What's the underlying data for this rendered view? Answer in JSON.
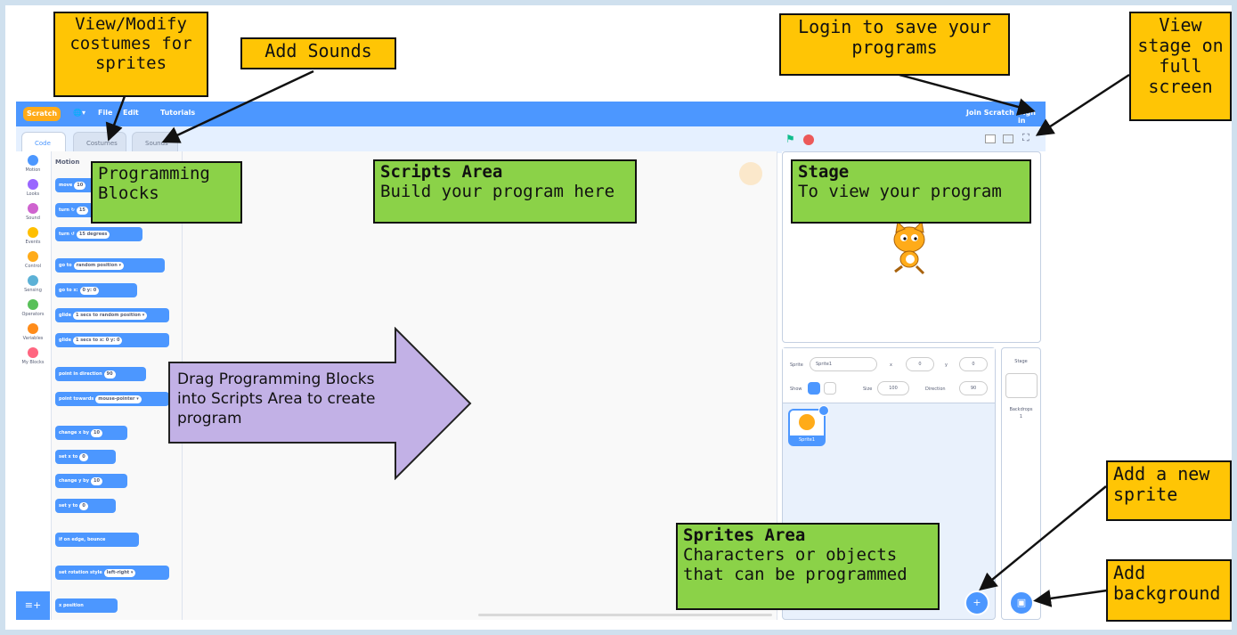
{
  "scratch_ui": {
    "topbar": {
      "logo": "Scratch",
      "menu": [
        "File",
        "Edit",
        "Tutorials"
      ],
      "join": "Join Scratch",
      "sign_in": "Sign in"
    },
    "tabs": [
      "Code",
      "Costumes",
      "Sounds"
    ],
    "categories": [
      {
        "label": "Motion",
        "color": "#4c97ff"
      },
      {
        "label": "Looks",
        "color": "#9966ff"
      },
      {
        "label": "Sound",
        "color": "#cf63cf"
      },
      {
        "label": "Events",
        "color": "#ffbf00"
      },
      {
        "label": "Control",
        "color": "#ffab19"
      },
      {
        "label": "Sensing",
        "color": "#5cb1d6"
      },
      {
        "label": "Operators",
        "color": "#59c059"
      },
      {
        "label": "Variables",
        "color": "#ff8c1a"
      },
      {
        "label": "My Blocks",
        "color": "#ff6680"
      }
    ],
    "palette_heading": "Motion",
    "blocks": [
      {
        "text": "move",
        "value": "10"
      },
      {
        "text": "turn ↻",
        "value": "15"
      },
      {
        "text": "turn ↺",
        "value": "15 degrees"
      },
      {
        "text": "go to",
        "value": "random position ▾"
      },
      {
        "text": "go to x:",
        "value": "0  y: 0"
      },
      {
        "text": "glide",
        "value": "1 secs to random position ▾"
      },
      {
        "text": "glide",
        "value": "1 secs to x: 0 y: 0"
      },
      {
        "text": "point in direction",
        "value": "90"
      },
      {
        "text": "point towards",
        "value": "mouse-pointer ▾"
      },
      {
        "text": "change x by",
        "value": "10"
      },
      {
        "text": "set x to",
        "value": "0"
      },
      {
        "text": "change y by",
        "value": "10"
      },
      {
        "text": "set y to",
        "value": "0"
      },
      {
        "text": "if on edge, bounce",
        "value": ""
      },
      {
        "text": "set rotation style",
        "value": "left-right ▾"
      },
      {
        "text": "x position",
        "value": ""
      }
    ],
    "sprite_info": {
      "sprite_label": "Sprite",
      "sprite_name": "Sprite1",
      "x_label": "x",
      "x_value": "0",
      "y_label": "y",
      "y_value": "0",
      "show_label": "Show",
      "size_label": "Size",
      "size_value": "100",
      "direction_label": "Direction",
      "direction_value": "90"
    },
    "sprite_tile_name": "Sprite1",
    "stage_pane": {
      "title": "Stage",
      "backdrops_label": "Backdrops",
      "backdrops_count": "1"
    }
  },
  "callouts": {
    "costumes": "View/Modify costumes for sprites",
    "sounds": "Add Sounds",
    "login": "Login to save your programs",
    "fullscreen": "View stage on full screen",
    "programming_blocks": "Programming Blocks",
    "scripts_title": "Scripts Area",
    "scripts_desc": "Build your program here",
    "stage_title": "Stage",
    "stage_desc": "To view your program",
    "drag_text": "Drag Programming Blocks into Scripts Area to create program",
    "sprites_title": "Sprites Area",
    "sprites_desc": "Characters or objects that can be programmed",
    "add_sprite": "Add a new sprite",
    "add_background": "Add background"
  }
}
